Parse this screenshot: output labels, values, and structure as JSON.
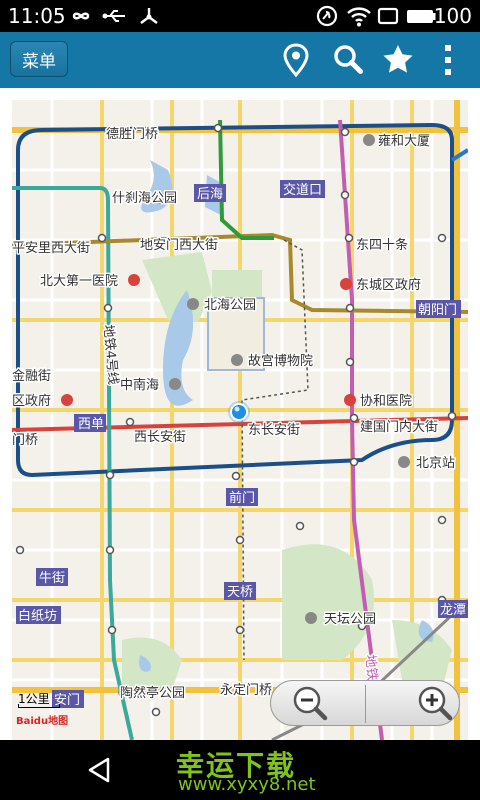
{
  "status_bar": {
    "time": "11:05",
    "battery": "100",
    "icons": [
      "infinity-icon",
      "usb-icon",
      "share-icon",
      "nfc-icon",
      "wifi-icon",
      "empty-icon",
      "battery-icon"
    ]
  },
  "action_bar": {
    "menu_label": "菜单",
    "icons": [
      "location-pin-icon",
      "search-icon",
      "favorite-star-icon",
      "overflow-menu-icon"
    ],
    "color": "#1577a6"
  },
  "map": {
    "labels": {
      "desheng": "德胜门桥",
      "yonghe": "雍和大厦",
      "shichahai": "什刹海公园",
      "houhai": "后海",
      "jiaodaokou": "交道口",
      "pinganli": "平安里西大街",
      "dianmen": "地安门西大街",
      "dongsi": "东四十条",
      "beida": "北大第一医院",
      "dongcheng": "东城区政府",
      "beihai": "北海公园",
      "chaoyangmen": "朝阳门",
      "gugong": "故宫博物院",
      "jinrong": "金融街",
      "zhongnanhai": "中南海",
      "subway": "地铁4号线",
      "xicheng": "区政府",
      "xiehe": "协和医院",
      "xidan": "西单",
      "xichang": "西长安街",
      "dongchang": "东长安街",
      "jianguomen": "建国门内大街",
      "fuxingmen": "门桥",
      "beijingzhan": "北京站",
      "qianmen": "前门",
      "niujie": "牛街",
      "tianqiao": "天桥",
      "tiantan": "天坛公园",
      "baizhifang": "白纸坊",
      "longtan": "龙潭",
      "taoranting": "陶然亭公园",
      "yongding": "永定门桥",
      "anmen": "安门",
      "line5": "地铁5号线"
    },
    "station_labels": [
      "houhai",
      "jiaodaokou",
      "chaoyangmen",
      "xidan",
      "qianmen",
      "niujie",
      "tianqiao",
      "baizhifang",
      "longtan",
      "anmen"
    ],
    "scale": "1公里",
    "logo": "Baidu地图",
    "zoom_out_icon": "zoom-out-icon",
    "zoom_in_icon": "zoom-in-icon",
    "colors": {
      "line2": "#1b4f8a",
      "line1": "#d9423b",
      "line4": "#3aa89a",
      "line5": "#c35db2",
      "line6": "#a88a2a",
      "line8": "#2f9a3a",
      "line10": "#2a78c8",
      "station": "#5a56a8",
      "park": "#d3e6c6",
      "water": "#a8c9e8"
    }
  },
  "nav_bar": {
    "back_icon": "back-triangle-icon",
    "watermark_title": "幸运下载",
    "watermark_url": "www.xyxy8.net"
  }
}
